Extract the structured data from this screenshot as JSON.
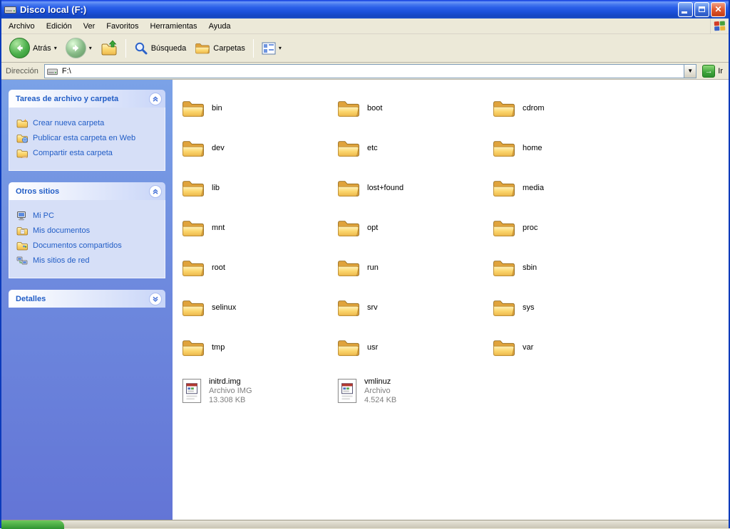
{
  "window": {
    "title": "Disco local (F:)"
  },
  "menu": {
    "items": [
      "Archivo",
      "Edición",
      "Ver",
      "Favoritos",
      "Herramientas",
      "Ayuda"
    ]
  },
  "toolbar": {
    "back_label": "Atrás",
    "search_label": "Búsqueda",
    "folders_label": "Carpetas"
  },
  "address": {
    "label": "Dirección",
    "value": "F:\\",
    "go_label": "Ir"
  },
  "sidebar": {
    "panels": [
      {
        "title": "Tareas de archivo y carpeta",
        "items": [
          "Crear nueva carpeta",
          "Publicar esta carpeta en Web",
          "Compartir esta carpeta"
        ]
      },
      {
        "title": "Otros sitios",
        "items": [
          "Mi PC",
          "Mis documentos",
          "Documentos compartidos",
          "Mis sitios de red"
        ]
      },
      {
        "title": "Detalles",
        "items": []
      }
    ]
  },
  "files": {
    "folders": [
      "bin",
      "boot",
      "cdrom",
      "dev",
      "etc",
      "home",
      "lib",
      "lost+found",
      "media",
      "mnt",
      "opt",
      "proc",
      "root",
      "run",
      "sbin",
      "selinux",
      "srv",
      "sys",
      "tmp",
      "usr",
      "var"
    ],
    "documents": [
      {
        "name": "initrd.img",
        "type": "Archivo IMG",
        "size": "13.308 KB"
      },
      {
        "name": "vmlinuz",
        "type": "Archivo",
        "size": "4.524 KB"
      }
    ]
  }
}
